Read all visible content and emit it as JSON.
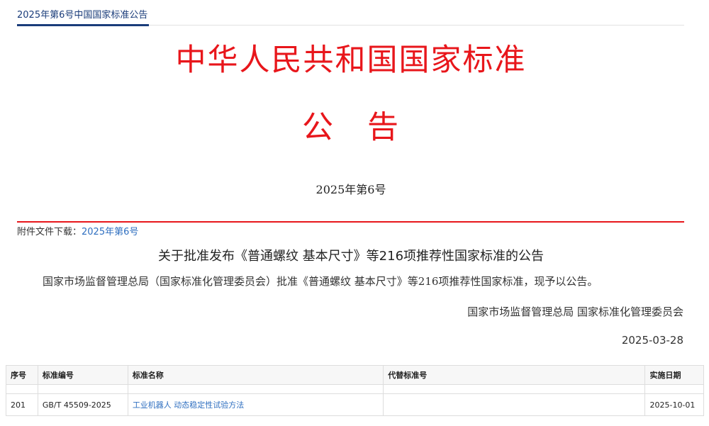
{
  "header": {
    "page_title": "2025年第6号中国国家标准公告"
  },
  "announcement": {
    "main_title": "中华人民共和国国家标准",
    "sub_title": "公　告",
    "issue_no": "2025年第6号"
  },
  "attachment": {
    "label": "附件文件下载：",
    "link_text": "2025年第6号"
  },
  "notice": {
    "title": "关于批准发布《普通螺纹 基本尺寸》等216项推荐性国家标准的公告",
    "body": "国家市场监督管理总局（国家标准化管理委员会）批准《普通螺纹 基本尺寸》等216项推荐性国家标准，现予以公告。",
    "issuer": "国家市场监督管理总局 国家标准化管理委员会",
    "date": "2025-03-28"
  },
  "table": {
    "columns": [
      "序号",
      "标准编号",
      "标准名称",
      "代替标准号",
      "实施日期"
    ],
    "rows": [
      {
        "no": "201",
        "code": "GB/T 45509-2025",
        "name": "工业机器人 动态稳定性试验方法",
        "replaces": "",
        "date": "2025-10-01"
      }
    ]
  },
  "colors": {
    "title_red": "#e8161b",
    "header_blue": "#1a3c7a",
    "link_blue": "#2f6fc0"
  }
}
